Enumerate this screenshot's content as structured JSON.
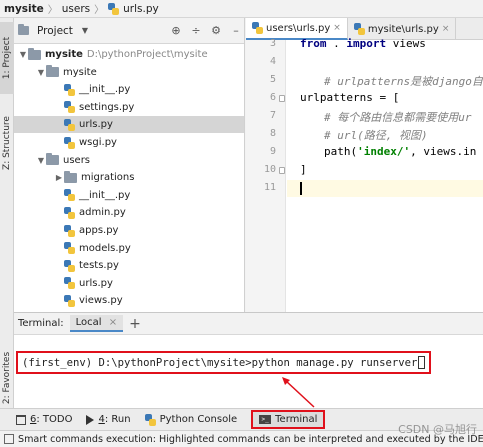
{
  "breadcrumb": {
    "items": [
      "mysite",
      "users",
      "urls.py"
    ]
  },
  "sidebar_tabs": {
    "project": "1: Project",
    "structure": "Z: Structure",
    "favorites": "2: Favorites"
  },
  "project_panel": {
    "title": "Project",
    "tree": [
      {
        "depth": 0,
        "kind": "folder",
        "expanded": true,
        "label": "mysite",
        "path": "D:\\pythonProject\\mysite"
      },
      {
        "depth": 1,
        "kind": "folder",
        "expanded": true,
        "label": "mysite"
      },
      {
        "depth": 2,
        "kind": "py",
        "label": "__init__.py"
      },
      {
        "depth": 2,
        "kind": "py",
        "label": "settings.py"
      },
      {
        "depth": 2,
        "kind": "py",
        "label": "urls.py",
        "selected": true
      },
      {
        "depth": 2,
        "kind": "py",
        "label": "wsgi.py"
      },
      {
        "depth": 1,
        "kind": "folder",
        "expanded": true,
        "label": "users"
      },
      {
        "depth": 2,
        "kind": "folder",
        "expanded": false,
        "label": "migrations"
      },
      {
        "depth": 2,
        "kind": "py",
        "label": "__init__.py"
      },
      {
        "depth": 2,
        "kind": "py",
        "label": "admin.py"
      },
      {
        "depth": 2,
        "kind": "py",
        "label": "apps.py"
      },
      {
        "depth": 2,
        "kind": "py",
        "label": "models.py"
      },
      {
        "depth": 2,
        "kind": "py",
        "label": "tests.py"
      },
      {
        "depth": 2,
        "kind": "py",
        "label": "urls.py"
      },
      {
        "depth": 2,
        "kind": "py",
        "label": "views.py"
      }
    ]
  },
  "editor": {
    "tabs": [
      {
        "label": "users\\urls.py",
        "active": true
      },
      {
        "label": "mysite\\urls.py",
        "active": false
      }
    ],
    "lines": [
      {
        "num": "3",
        "text": "from . import views"
      },
      {
        "num": "4",
        "text": ""
      },
      {
        "num": "5",
        "text": "# urlpatterns是被django自动识"
      },
      {
        "num": "6",
        "text": "urlpatterns = ["
      },
      {
        "num": "7",
        "text": "# 每个路由信息都需要使用ur"
      },
      {
        "num": "8",
        "text": "# url(路径, 视图)"
      },
      {
        "num": "9",
        "text": "path('index/', views.in"
      },
      {
        "num": "10",
        "text": "]"
      },
      {
        "num": "11",
        "text": ""
      }
    ],
    "current_line": "11"
  },
  "terminal": {
    "title": "Terminal:",
    "tab": "Local",
    "prompt": "(first_env) D:\\pythonProject\\mysite>",
    "command": "python manage.py runserver"
  },
  "tool_windows": [
    {
      "key": "6",
      "label": ": TODO"
    },
    {
      "key": "4",
      "label": ": Run"
    },
    {
      "key": "",
      "label": "Python Console"
    },
    {
      "key": "",
      "label": "Terminal",
      "highlighted": true
    }
  ],
  "status_bar": {
    "text": "Smart commands execution: Highlighted commands can be interpreted and executed by the IDE in"
  },
  "watermark": "CSDN @马旭行",
  "colors": {
    "highlight_box": "#e0101b",
    "accent": "#4a88c7"
  }
}
